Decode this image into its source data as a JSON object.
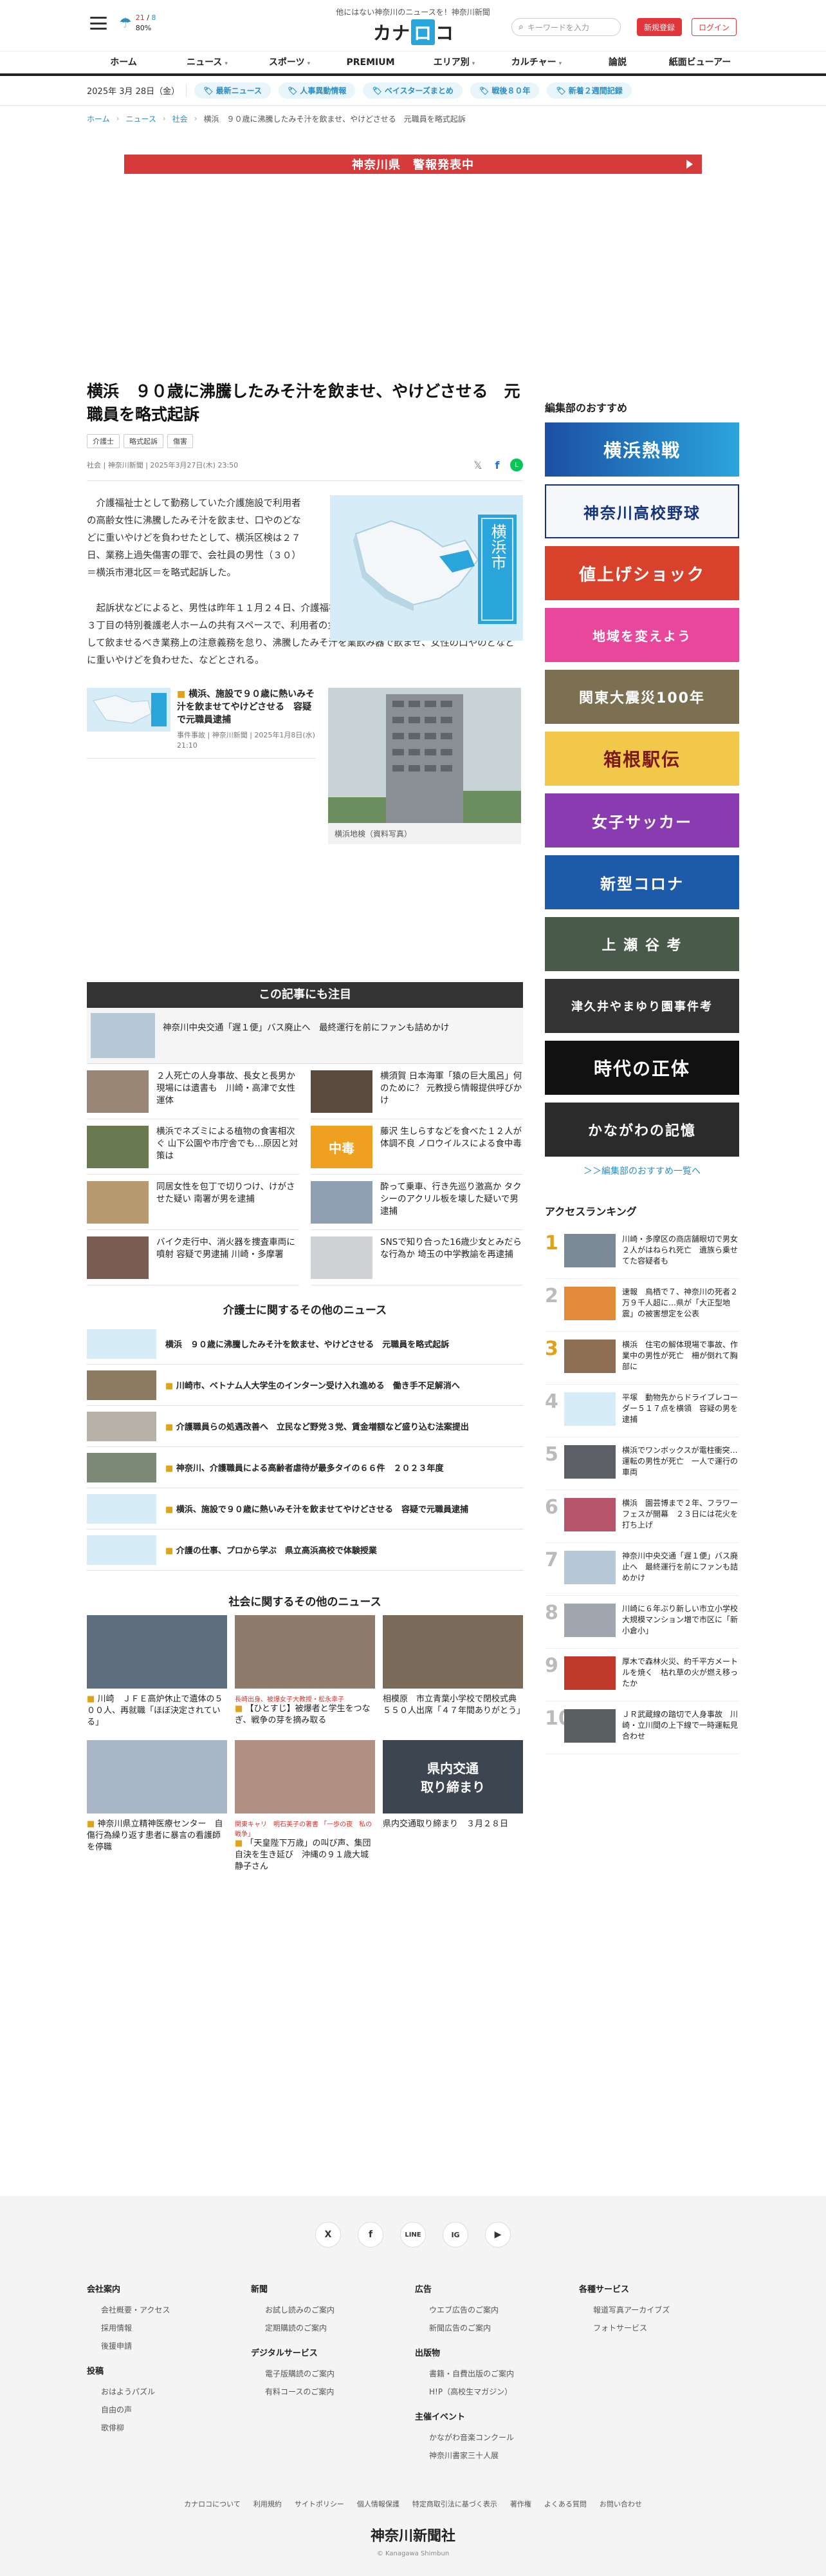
{
  "header": {
    "tagline": "他にはない神奈川のニュースを！神奈川新聞",
    "weather_hi": "21",
    "weather_lo": "8",
    "weather_pct": "80",
    "logo_left": "カナ",
    "logo_mark": "ロ",
    "logo_right": "コ",
    "search_placeholder": "キーワードを入力",
    "register_label": "新規登録",
    "login_label": "ログイン"
  },
  "nav": [
    {
      "label": "ホーム",
      "dd": ""
    },
    {
      "label": "ニュース",
      "dd": "▾"
    },
    {
      "label": "スポーツ",
      "dd": "▾"
    },
    {
      "label": "PREMIUM",
      "dd": ""
    },
    {
      "label": "エリア別",
      "dd": "▾"
    },
    {
      "label": "カルチャー",
      "dd": "▾"
    },
    {
      "label": "論説",
      "dd": ""
    },
    {
      "label": "紙面ビューアー",
      "dd": ""
    }
  ],
  "subbar": {
    "date": "2025年 3月 28日（金）",
    "chips": [
      "最新ニュース",
      "人事異動情報",
      "ベイスターズまとめ",
      "戦後８０年",
      "新着２週間記録"
    ]
  },
  "breadcrumb": [
    "ホーム",
    "ニュース",
    "社会",
    "横浜　９０歳に沸騰したみそ汁を飲ませ、やけどさせる　元職員を略式起訴"
  ],
  "alert": "神奈川県　警報発表中",
  "article": {
    "title": "横浜　９０歳に沸騰したみそ汁を飲ませ、やけどさせる　元職員を略式起訴",
    "tags": [
      "介護士",
      "略式起訴",
      "傷害"
    ],
    "meta": "社会 | 神奈川新聞 | 2025年3月27日(木) 23:50",
    "map_label": "横浜市",
    "p1": "介護福祉士として勤務していた介護施設で利用者の高齢女性に沸騰したみそ汁を飲ませ、口やのどなどに重いやけどを負わせたとして、横浜区検は２７日、業務上過失傷害の罪で、会社員の男性（３０）＝横浜市港北区＝を略式起訴した。",
    "p2": "起訴状などによると、男性は昨年１１月２４日、介護福祉士として勤務していた同市鶴見区獅子ケ谷３丁目の特別養護老人ホームの共有スペースで、利用者の女性（９０）にみそ汁を提供する際、適温にして飲ませるべき業務上の注意義務を怠り、沸騰したみそ汁を業飲み器で飲ませ、女性の口やのどなどに重いやけどを負わせた、などとされる。",
    "related_title_badge": "■",
    "related_title": "横浜、施設で９０歳に熱いみそ汁を飲ませてやけどさせる　容疑で元職員逮捕",
    "related_meta": "事件事故 | 神奈川新聞 | 2025年1月8日(水) 21:10",
    "photo_caption": "横浜地検（資料写真）"
  },
  "notice": {
    "heading": "この記事にも注目",
    "feature": "神奈川中央交通「遅１便」バス廃止へ　最終運行を前にファンも詰めかけ",
    "grid": [
      "２人死亡の人身事故、長女と長男か　現場には遺書も　川崎・高津で女性運体",
      "横須賀 日本海軍「猿の巨大風呂」何のために？ 元教授ら情報提供呼びかけ",
      "横浜でネズミによる植物の食害相次ぐ 山下公園や市庁舎でも…原因と対策は",
      "藤沢 生しらすなどを食べた１２人が体調不良 ノロウイルスによる食中毒",
      "同居女性を包丁で切りつけ、けがさせた疑い 南署が男を逮捕",
      "酔って乗車、行き先巡り激高か タクシーのアクリル板を壊した疑いで男逮捕",
      "バイク走行中、消火器を捜査車両に噴射 容疑で男逮捕 川崎・多摩署",
      "SNSで知り合った16歳少女とみだらな行為か 埼玉の中学教諭を再逮捕"
    ],
    "more_heading": "介護士に関するその他のニュース",
    "more": [
      "横浜　９０歳に沸騰したみそ汁を飲ませ、やけどさせる　元職員を略式起訴",
      "川崎市、ベトナム人大学生のインターン受け入れ進める　働き手不足解消へ",
      "介護職員らの処遇改善へ　立民など野党３党、賃金増額など盛り込む法案提出",
      "神奈川、介護職員による高齢者虐待が最多タイの６６件　２０２３年度",
      "横浜、施設で９０歳に熱いみそ汁を飲ませてやけどさせる　容疑で元職員逮捕",
      "介護の仕事、プロから学ぶ　県立高浜高校で体験授業"
    ],
    "social_heading": "社会に関するその他のニュース",
    "cards": [
      {
        "red": "",
        "text": "川崎　ＪＦＥ高炉休止で遺体の５００人、再就職「ほぼ決定されている」"
      },
      {
        "red": "長崎出身、被爆女子大教授・松永幸子",
        "text": "【ひとすじ】被爆者と学生をつなぎ、戦争の芽を摘み取る"
      },
      {
        "red": "",
        "text": "相模原　市立青葉小学校で閉校式典　５５０人出席「４７年間ありがとう」"
      },
      {
        "red": "",
        "text": "神奈川県立精神医療センター　自傷行為繰り返す患者に暴言の看護師を停職"
      },
      {
        "red": "関東キャリ　明石美子の著書 「一歩の夜　私の戦争」",
        "text": "「天皇陛下万歳」の叫び声、集団自決を生き延び　沖縄の９１歳大城静子さん"
      },
      {
        "red": "",
        "text": "県内交通取り締まり　３月２８日"
      }
    ],
    "card5_img": "県内交通\n取り締まり"
  },
  "sidebar": {
    "heading": "編集部のおすすめ",
    "banners": [
      "横浜熱戦",
      "神奈川高校野球",
      "値上げショック",
      "地域を変えよう",
      "関東大震災100年",
      "箱根駅伝",
      "女子サッカー",
      "新型コロナ",
      "上 瀬 谷 考",
      "津久井やまゆり園事件考",
      "時代の正体",
      "かながわの記憶"
    ],
    "more": "＞＞編集部のおすすめ一覧へ",
    "rank_heading": "アクセスランキング",
    "ranks": [
      "川崎・多摩区の商店舗眼切で男女２人がはねられ死亡　遺族ら乗せてた容疑者も",
      "速報　鳥栖で７、神奈川の死者２万９千人超に…県が「大正型地震」の被害想定を公表",
      "横浜　住宅の解体現場で事故、作業中の男性が死亡　柵が倒れて胸部に",
      "平塚　動物先からドライブレコーダー５１７点を横領　容疑の男を逮捕",
      "横浜でワンボックスが電柱衝突…運転の男性が死亡　一人で運行の車両",
      "横浜　園芸博まで２年、フラワーフェスが開幕　２３日には花火を打ち上げ",
      "神奈川中央交通「遅１便」バス廃止へ　最終運行を前にファンも詰めかけ",
      "川崎に６年ぶり新しい市立小学校　大規模マンション増で市区に「新小倉小」",
      "厚木で森林火災、約千平方メートルを焼く　枯れ草の火が燃え移ったか",
      "ＪＲ武蔵線の踏切で人身事故　川崎・立川間の上下線で一時運転見合わせ"
    ]
  },
  "footer": {
    "social": [
      "X",
      "f",
      "LINE",
      "IG",
      "▶"
    ],
    "cols": [
      {
        "groups": [
          {
            "h": "会社案内",
            "items": [
              "会社概要・アクセス",
              "採用情報",
              "後援申請"
            ]
          },
          {
            "h": "投稿",
            "items": [
              "おはようパズル",
              "自由の声",
              "歌俳柳"
            ]
          }
        ]
      },
      {
        "groups": [
          {
            "h": "新聞",
            "items": [
              "お試し読みのご案内",
              "定期購読のご案内"
            ]
          },
          {
            "h": "デジタルサービス",
            "items": [
              "電子版購読のご案内",
              "有料コースのご案内"
            ]
          }
        ]
      },
      {
        "groups": [
          {
            "h": "広告",
            "items": [
              "ウエブ広告のご案内",
              "新聞広告のご案内"
            ]
          },
          {
            "h": "出版物",
            "items": [
              "書籍・自費出版のご案内",
              "H!P（高校生マガジン）"
            ]
          },
          {
            "h": "主催イベント",
            "items": [
              "かながわ音楽コンクール",
              "神奈川書家三十人展"
            ]
          }
        ]
      },
      {
        "groups": [
          {
            "h": "各種サービス",
            "items": [
              "報道写真アーカイブズ",
              "フォトサービス"
            ]
          }
        ]
      }
    ],
    "bottom_links": [
      "カナロコについて",
      "利用規約",
      "サイトポリシー",
      "個人情報保護",
      "特定商取引法に基づく表示",
      "著作権",
      "よくある質問",
      "お問い合わせ"
    ],
    "logo": "神奈川新聞社",
    "copyright": "© Kanagawa Shimbun"
  }
}
